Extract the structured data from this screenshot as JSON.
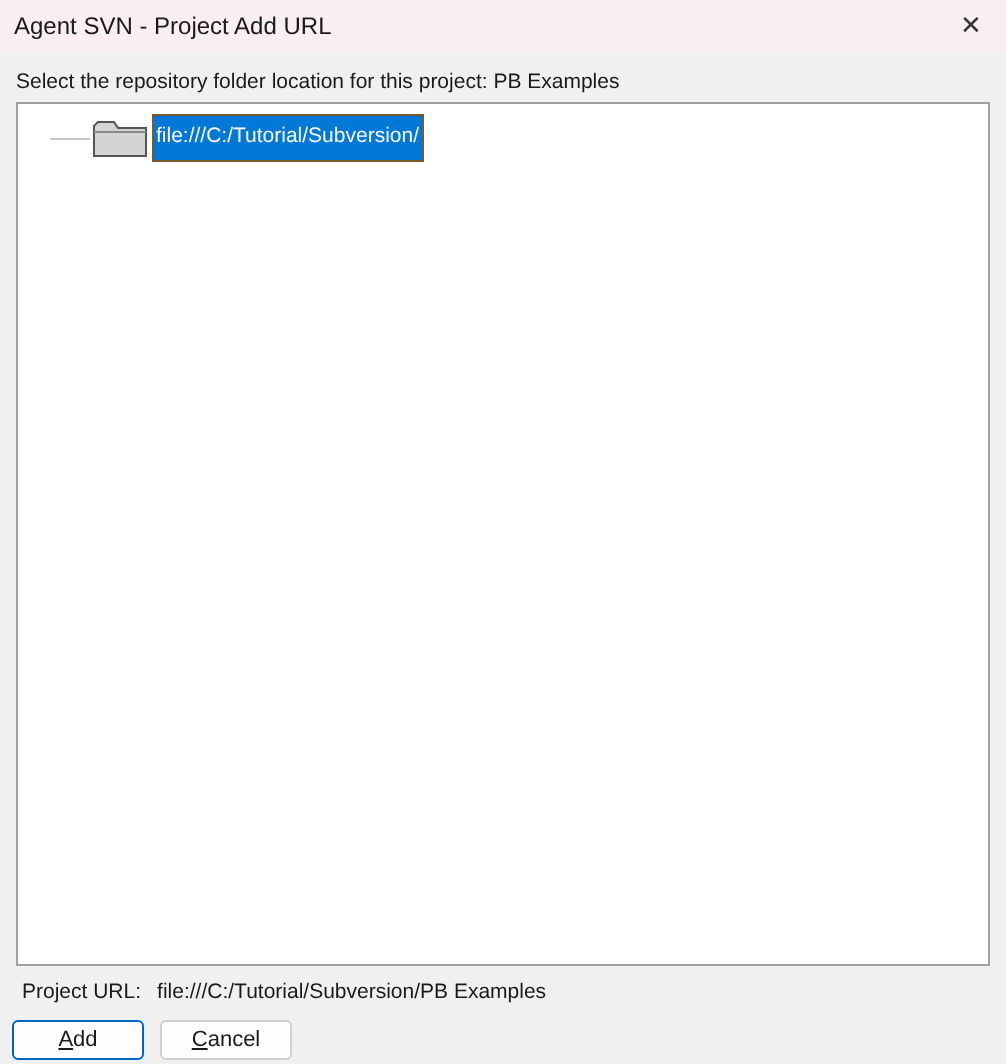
{
  "window": {
    "title": "Agent SVN - Project Add URL",
    "close": "✕"
  },
  "instruction": "Select the repository folder location for this project: PB Examples",
  "tree": {
    "items": [
      {
        "label": "file:///C:/Tutorial/Subversion/",
        "selected": true
      }
    ]
  },
  "project_url": {
    "label": "Project URL:",
    "value": "file:///C:/Tutorial/Subversion/PB Examples"
  },
  "buttons": [
    {
      "label": "Add",
      "default": true,
      "underline_first": true
    },
    {
      "label": "Cancel",
      "default": false,
      "underline_first": true
    }
  ]
}
